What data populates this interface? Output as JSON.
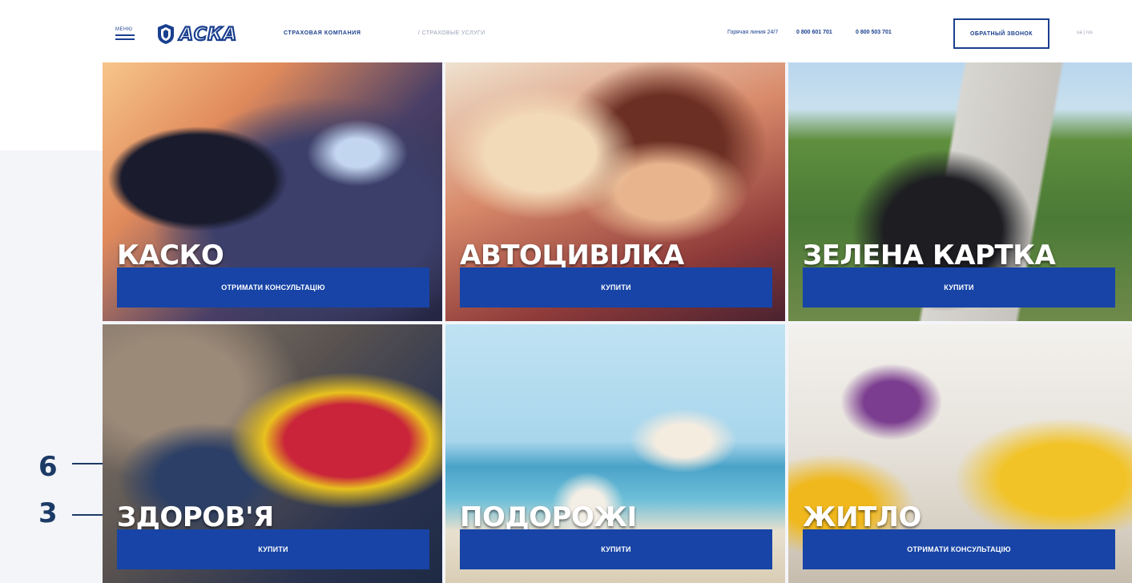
{
  "header": {
    "menu_label": "МЕНЮ",
    "logo_text": "АСКА",
    "company": "СТРАХОВАЯ КОМПАНИЯ",
    "breadcrumb": "/ СТРАХОВЫЕ УСЛУГИ",
    "hotline": "Горячая линия 24/7",
    "phone1": "0 800 601 701",
    "phone2": "0 800 503 701",
    "callback": "ОБРАТНЫЙ ЗВОНОК",
    "lang": "ua | rus"
  },
  "tiles": [
    {
      "title": "КАСКО",
      "button": "ОТРИМАТИ КОНСУЛЬТАЦІЮ"
    },
    {
      "title": "АВТОЦИВІЛКА",
      "button": "КУПИТИ"
    },
    {
      "title": "ЗЕЛЕНА КАРТКА",
      "button": "КУПИТИ"
    },
    {
      "title": "ЗДОРОВ'Я",
      "button": "КУПИТИ"
    },
    {
      "title": "ПОДОРОЖІ",
      "button": "КУПИТИ"
    },
    {
      "title": "ЖИТЛО",
      "button": "ОТРИМАТИ КОНСУЛЬТАЦІЮ"
    }
  ],
  "callouts": {
    "first": "6",
    "second": "3"
  },
  "colors": {
    "brand_blue": "#1744a6",
    "callout_navy": "#1c3a66"
  }
}
